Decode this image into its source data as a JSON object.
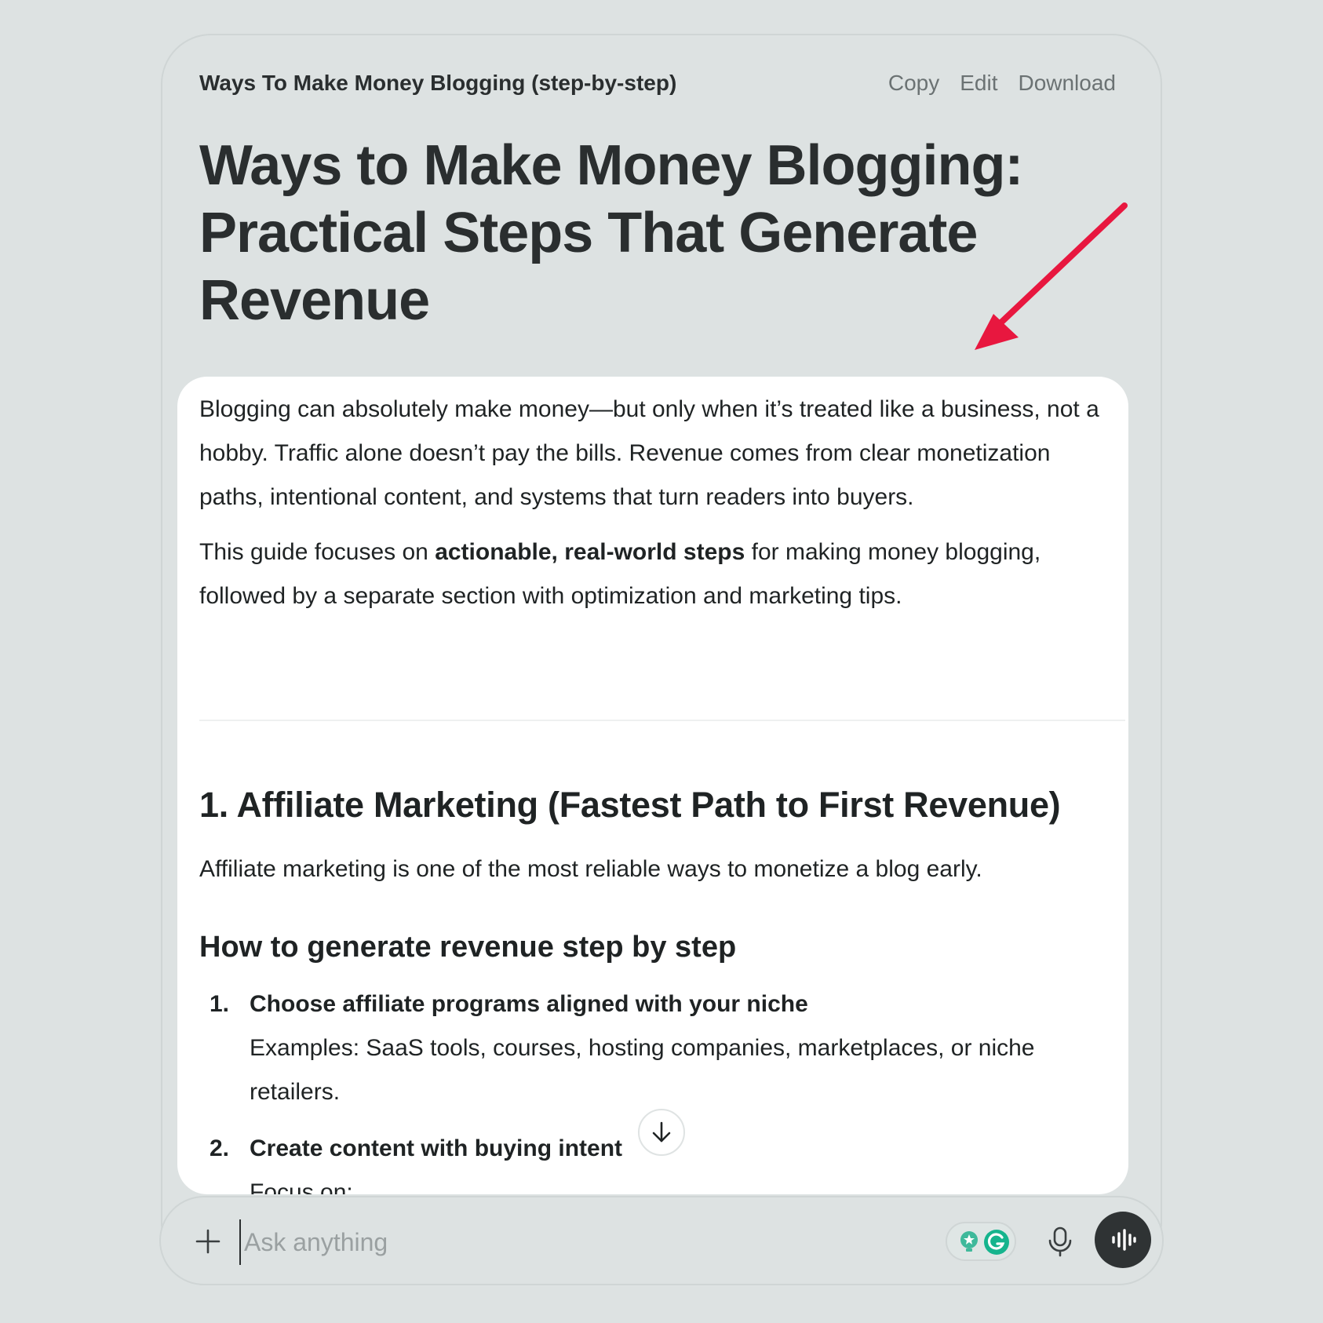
{
  "doc": {
    "name": "Ways To Make Money Blogging (step-by-step)",
    "actions": {
      "copy": "Copy",
      "edit": "Edit",
      "download": "Download"
    },
    "title": "Ways to Make Money Blogging: Practical Steps That Generate Revenue"
  },
  "content": {
    "intro_p1": "Blogging can absolutely make money—but only when it’s treated like a business, not a hobby. Traffic alone doesn’t pay the bills. Revenue comes from clear monetization paths, intentional content, and systems that turn readers into buyers.",
    "intro_p2_before": "This guide focuses on ",
    "intro_p2_bold": "actionable, real-world steps",
    "intro_p2_after": " for making money blogging, followed by a separate section with optimization and marketing tips.",
    "section1_heading": "1. Affiliate Marketing (Fastest Path to First Revenue)",
    "section1_intro": "Affiliate marketing is one of the most reliable ways to monetize a blog early.",
    "subheading": "How to generate revenue step by step",
    "steps": [
      {
        "num": "1.",
        "title": "Choose affiliate programs aligned with your niche",
        "body": "Examples: SaaS tools, courses, hosting companies, marketplaces, or niche retailers."
      },
      {
        "num": "2.",
        "title": "Create content with buying intent",
        "body": "Focus on:"
      }
    ]
  },
  "composer": {
    "placeholder": "Ask anything"
  },
  "colors": {
    "annotation_arrow": "#e8173f",
    "panel": "#ffffff",
    "background": "#dde2e2"
  },
  "icons": [
    "down-arrow-icon",
    "plus-icon",
    "grammarly-icon",
    "lightbulb-icon",
    "microphone-icon",
    "voice-waveform-icon"
  ]
}
